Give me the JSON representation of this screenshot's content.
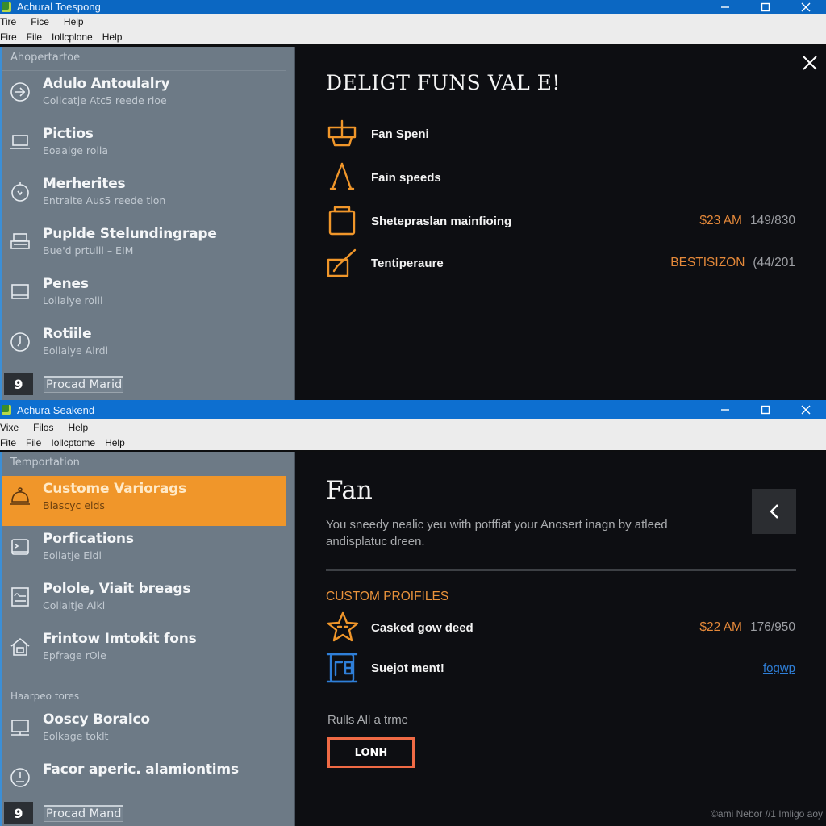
{
  "window1": {
    "title": "Achural Toespong",
    "controls": {
      "minimize": "—",
      "maximize": "□",
      "close": "✕"
    },
    "menu_row1": [
      "Tire",
      "Fice",
      "Help"
    ],
    "menu_row2": [
      "Fire",
      "File",
      "Iollcplone",
      "Help"
    ],
    "sidebar": {
      "header": "Ahopertartoe",
      "items": [
        {
          "title": "Adulo Antoulalry",
          "subtitle": "Collcatje Atc5 reede rioe",
          "icon": "circle-arrow-icon"
        },
        {
          "title": "Pictios",
          "subtitle": "Eoaalge rolia",
          "icon": "laptop-icon"
        },
        {
          "title": "Merherites",
          "subtitle": "Entraite Aus5 reede tion",
          "icon": "stopwatch-icon"
        },
        {
          "title": "Puplde Stelundingrape",
          "subtitle": "Bue'd prtulil – EIM",
          "icon": "printer-icon"
        },
        {
          "title": "Penes",
          "subtitle": "Lollaiye rolil",
          "icon": "monitor-icon"
        },
        {
          "title": "Rotiile",
          "subtitle": "Eollaiye Alrdi",
          "icon": "clock-icon"
        }
      ],
      "footer_label": "Procad Marid",
      "footer_icon": "9"
    },
    "panel": {
      "title": "DELIGT FUNS VAL E!",
      "options": [
        {
          "label": "Fan Speni",
          "icon": "crown-icon",
          "value": "",
          "ratio": ""
        },
        {
          "label": "Fain speeds",
          "icon": "compass-icon",
          "value": "",
          "ratio": ""
        },
        {
          "label": "Shetepraslan mainfioing",
          "icon": "briefcase-icon",
          "value": "$23 AM",
          "ratio": "149/830"
        },
        {
          "label": "Tentiperaure",
          "icon": "edit-checkbox-icon",
          "value": "BESTISIZON",
          "ratio": "(44/201"
        }
      ]
    }
  },
  "window2": {
    "title": "Achura Seakend",
    "controls": {
      "minimize": "—",
      "maximize": "□",
      "close": "✕"
    },
    "menu_row1": [
      "Vixe",
      "Filos",
      "Help"
    ],
    "menu_row2": [
      "Fite",
      "File",
      "Iollcptome",
      "Help"
    ],
    "sidebar": {
      "header": "Temportation",
      "items": [
        {
          "title": "Custome Variorags",
          "subtitle": "Blascyc elds",
          "icon": "bell-icon",
          "active": true
        },
        {
          "title": "Porfications",
          "subtitle": "Eollatje Eldl",
          "icon": "document-icon"
        },
        {
          "title": "Polole, Viait breags",
          "subtitle": "Collaitje Alkl",
          "icon": "chart-window-icon"
        },
        {
          "title": "Frintow Imtokit fons",
          "subtitle": "Epfrage rOle",
          "icon": "home-icon"
        }
      ],
      "section2_label": "Haarpeo tores",
      "items2": [
        {
          "title": "Ooscy Boralco",
          "subtitle": "Eolkage toklt",
          "icon": "monitor-icon"
        },
        {
          "title": "Facor aperic. alamiontims",
          "subtitle": "",
          "icon": "gauge-icon"
        }
      ],
      "footer_label": "Procad Mand",
      "footer_icon": "9"
    },
    "panel": {
      "title": "Fan",
      "description": "You sneedy nealic yeu with potffiat your Anosert inagn by atleed andisplatuc dreen.",
      "back_icon": "chevron-left-icon",
      "section_label": "CUSTOM PROIFILES",
      "options": [
        {
          "label": "Casked gow deed",
          "icon": "star-icon",
          "value": "$22 AM",
          "ratio": "176/950"
        },
        {
          "label": "Suejot ment!",
          "icon": "scroll-document-icon",
          "link": "fogwp"
        }
      ],
      "rules_text": "Rulls All a trme",
      "action_button": "LONH",
      "watermark": "©ami Nebor //1 Imligo aoy"
    }
  },
  "colors": {
    "titlebar": "#0b67c2",
    "sidebar": "#6d7a86",
    "panel_bg": "#0d0e12",
    "accent_orange": "#f0962a",
    "link_blue": "#2f7fd8",
    "button_border": "#ef6a45"
  }
}
